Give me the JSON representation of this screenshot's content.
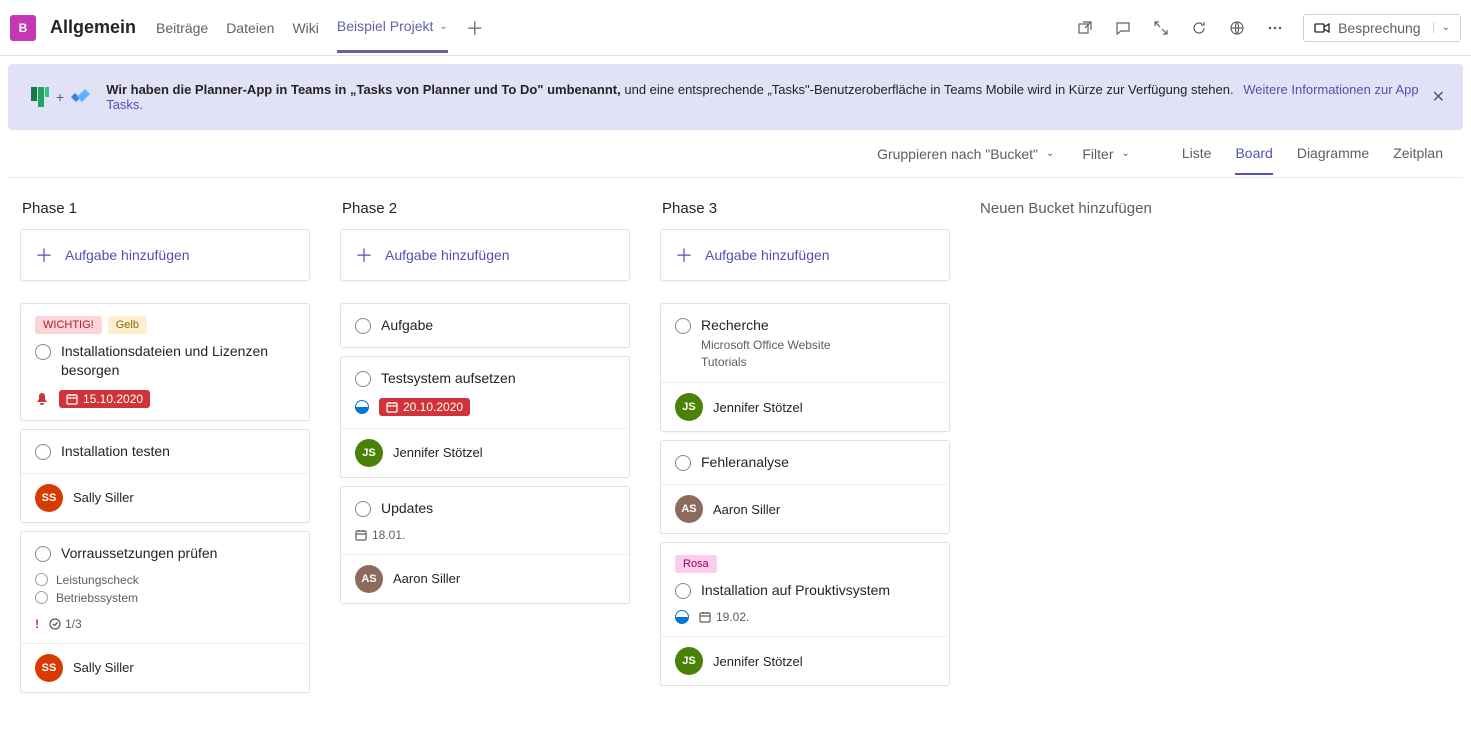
{
  "header": {
    "team_initial": "B",
    "team_name": "Allgemein",
    "tabs": [
      "Beiträge",
      "Dateien",
      "Wiki"
    ],
    "active_tab": "Beispiel Projekt",
    "meeting_label": "Besprechung"
  },
  "banner": {
    "bold_text": "Wir haben die Planner-App in Teams in „Tasks von Planner und To Do\" umbenannt, ",
    "rest_text": "und eine entsprechende „Tasks\"-Benutzeroberfläche in Teams Mobile wird in Kürze zur Verfügung stehen.",
    "link_text": "Weitere Informationen zur App Tasks."
  },
  "toolbar": {
    "group_label": "Gruppieren nach \"Bucket\"",
    "filter_label": "Filter",
    "views": {
      "list": "Liste",
      "board": "Board",
      "charts": "Diagramme",
      "schedule": "Zeitplan"
    }
  },
  "board": {
    "add_task_label": "Aufgabe hinzufügen",
    "new_bucket_label": "Neuen Bucket hinzufügen",
    "buckets": [
      {
        "name": "Phase 1",
        "cards": [
          {
            "tags": [
              {
                "text": "WICHTIG!",
                "cls": "red"
              },
              {
                "text": "Gelb",
                "cls": "yellow"
              }
            ],
            "title": "Installationsdateien und Lizenzen besorgen",
            "bell": true,
            "date": {
              "text": "15.10.2020",
              "overdue": true
            }
          },
          {
            "title": "Installation testen",
            "assignee": {
              "initials": "SS",
              "cls": "orange",
              "name": "Sally Siller"
            }
          },
          {
            "title": "Vorraussetzungen prüfen",
            "checklist": [
              "Leistungscheck",
              "Betriebssystem"
            ],
            "priority": true,
            "progress_count": "1/3",
            "assignee": {
              "initials": "SS",
              "cls": "orange",
              "name": "Sally Siller"
            }
          }
        ]
      },
      {
        "name": "Phase 2",
        "cards": [
          {
            "title": "Aufgabe"
          },
          {
            "title": "Testsystem aufsetzen",
            "progress": true,
            "date": {
              "text": "20.10.2020",
              "overdue": true
            },
            "assignee": {
              "initials": "JS",
              "cls": "green",
              "name": "Jennifer Stötzel"
            }
          },
          {
            "title": "Updates",
            "plain_date": "18.01.",
            "assignee": {
              "initials": "AS",
              "cls": "photo",
              "name": "Aaron Siller"
            }
          }
        ]
      },
      {
        "name": "Phase 3",
        "cards": [
          {
            "title": "Recherche",
            "subtitle": "Microsoft Office Website\nTutorials",
            "assignee": {
              "initials": "JS",
              "cls": "green",
              "name": "Jennifer Stötzel"
            }
          },
          {
            "title": "Fehleranalyse",
            "assignee": {
              "initials": "AS",
              "cls": "photo",
              "name": "Aaron Siller"
            }
          },
          {
            "tags": [
              {
                "text": "Rosa",
                "cls": "pink"
              }
            ],
            "title": "Installation auf Prouktivsystem",
            "progress": true,
            "plain_date": "19.02.",
            "assignee": {
              "initials": "JS",
              "cls": "green",
              "name": "Jennifer Stötzel"
            }
          }
        ]
      }
    ]
  }
}
